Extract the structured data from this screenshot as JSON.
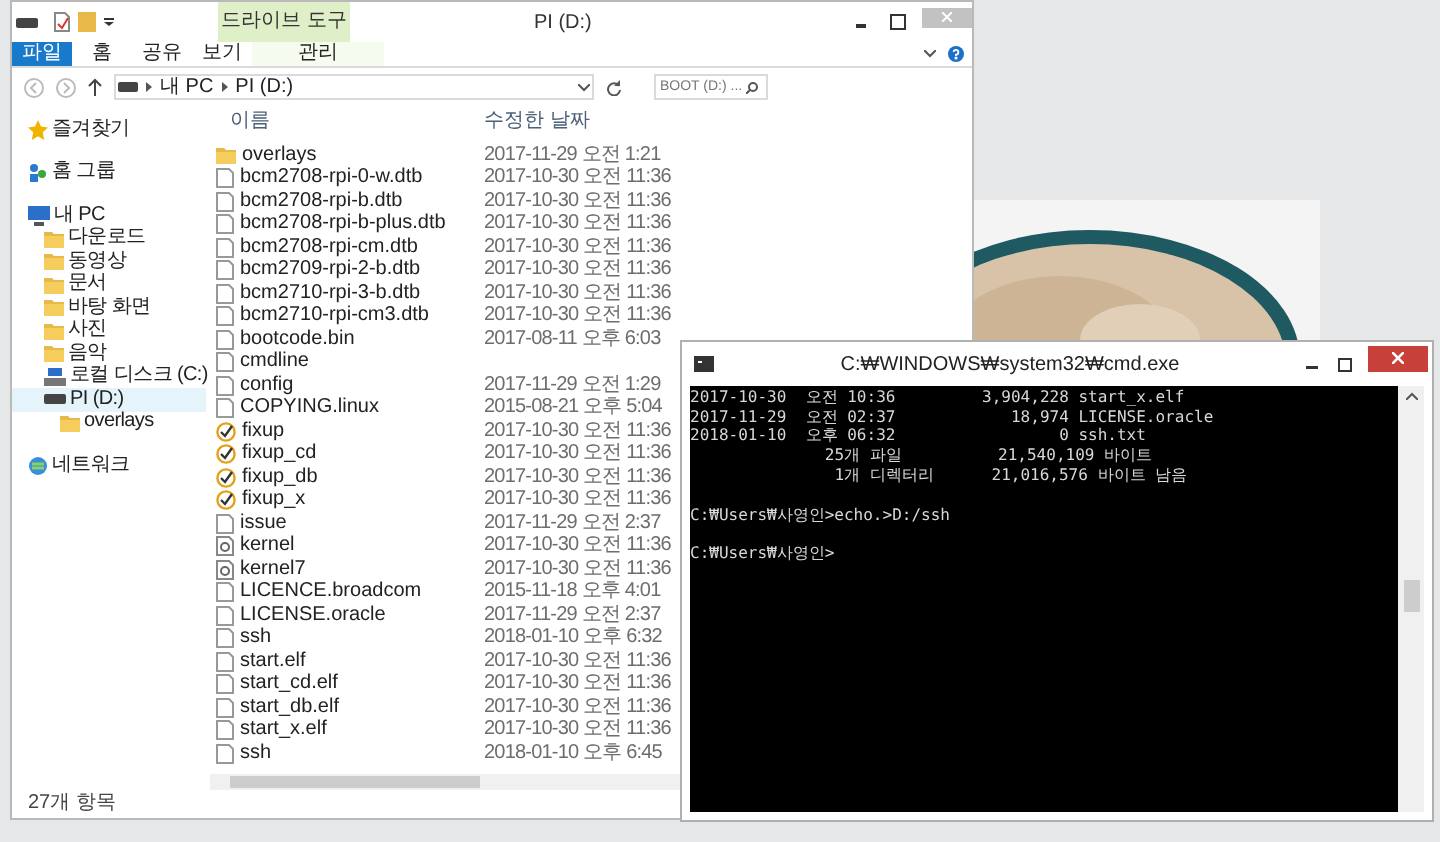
{
  "explorer": {
    "title": "PI (D:)",
    "context_label": "드라이브 도구",
    "ribbon_tabs": [
      {
        "label": "파일",
        "kind": "file"
      },
      {
        "label": "홈",
        "kind": "tab"
      },
      {
        "label": "공유",
        "kind": "tab"
      },
      {
        "label": "보기",
        "kind": "tab"
      },
      {
        "label": "관리",
        "kind": "context"
      }
    ],
    "breadcrumb": [
      "내 PC",
      "PI (D:)"
    ],
    "search": {
      "placeholder": "BOOT (D:) ..."
    },
    "nav": [
      {
        "label": "즐겨찾기",
        "kind": "star",
        "selected": false
      },
      {
        "label": "홈 그룹",
        "kind": "group",
        "selected": false
      },
      {
        "label": "내 PC",
        "kind": "pc",
        "selected": false,
        "children": [
          {
            "label": "다운로드",
            "kind": "folder",
            "selected": false
          },
          {
            "label": "동영상",
            "kind": "folder",
            "selected": false
          },
          {
            "label": "문서",
            "kind": "folder",
            "selected": false
          },
          {
            "label": "바탕 화면",
            "kind": "folder",
            "selected": false
          },
          {
            "label": "사진",
            "kind": "folder",
            "selected": false
          },
          {
            "label": "음악",
            "kind": "folder",
            "selected": false
          },
          {
            "label": "로컬 디스크 (C:)",
            "kind": "disk",
            "selected": false
          },
          {
            "label": "PI (D:)",
            "kind": "drive",
            "selected": true,
            "children": [
              {
                "label": "overlays",
                "kind": "folder",
                "selected": false
              }
            ]
          }
        ]
      },
      {
        "label": "네트워크",
        "kind": "network",
        "selected": false
      }
    ],
    "columns": [
      "이름",
      "수정한 날짜"
    ],
    "files": [
      {
        "name": "overlays",
        "date": "2017-11-29 오전 1:21",
        "kind": "folder"
      },
      {
        "name": "bcm2708-rpi-0-w.dtb",
        "date": "2017-10-30 오전 11:36",
        "kind": "file"
      },
      {
        "name": "bcm2708-rpi-b.dtb",
        "date": "2017-10-30 오전 11:36",
        "kind": "file"
      },
      {
        "name": "bcm2708-rpi-b-plus.dtb",
        "date": "2017-10-30 오전 11:36",
        "kind": "file"
      },
      {
        "name": "bcm2708-rpi-cm.dtb",
        "date": "2017-10-30 오전 11:36",
        "kind": "file"
      },
      {
        "name": "bcm2709-rpi-2-b.dtb",
        "date": "2017-10-30 오전 11:36",
        "kind": "file"
      },
      {
        "name": "bcm2710-rpi-3-b.dtb",
        "date": "2017-10-30 오전 11:36",
        "kind": "file"
      },
      {
        "name": "bcm2710-rpi-cm3.dtb",
        "date": "2017-10-30 오전 11:36",
        "kind": "file"
      },
      {
        "name": "bootcode.bin",
        "date": "2017-08-11 오후 6:03",
        "kind": "file"
      },
      {
        "name": "cmdline",
        "kind": "file"
      },
      {
        "name": "config",
        "date": "2017-11-29 오전 1:29",
        "kind": "file"
      },
      {
        "name": "COPYING.linux",
        "date": "2015-08-21 오후 5:04",
        "kind": "file"
      },
      {
        "name": "fixup",
        "date": "2017-10-30 오전 11:36",
        "kind": "check"
      },
      {
        "name": "fixup_cd",
        "date": "2017-10-30 오전 11:36",
        "kind": "check"
      },
      {
        "name": "fixup_db",
        "date": "2017-10-30 오전 11:36",
        "kind": "check"
      },
      {
        "name": "fixup_x",
        "date": "2017-10-30 오전 11:36",
        "kind": "check"
      },
      {
        "name": "issue",
        "date": "2017-11-29 오전 2:37",
        "kind": "file"
      },
      {
        "name": "kernel",
        "date": "2017-10-30 오전 11:36",
        "kind": "system"
      },
      {
        "name": "kernel7",
        "date": "2017-10-30 오전 11:36",
        "kind": "system"
      },
      {
        "name": "LICENCE.broadcom",
        "date": "2015-11-18 오후 4:01",
        "kind": "file"
      },
      {
        "name": "LICENSE.oracle",
        "date": "2017-11-29 오전 2:37",
        "kind": "file"
      },
      {
        "name": "ssh",
        "date": "2018-01-10 오후 6:32",
        "kind": "file"
      },
      {
        "name": "start.elf",
        "date": "2017-10-30 오전 11:36",
        "kind": "file"
      },
      {
        "name": "start_cd.elf",
        "date": "2017-10-30 오전 11:36",
        "kind": "file"
      },
      {
        "name": "start_db.elf",
        "date": "2017-10-30 오전 11:36",
        "kind": "file"
      },
      {
        "name": "start_x.elf",
        "date": "2017-10-30 오전 11:36",
        "kind": "file"
      },
      {
        "name": "ssh",
        "date": "2018-01-10 오후 6:45",
        "kind": "file"
      }
    ],
    "status": "27개 항목"
  },
  "console": {
    "title": "C:₩WINDOWS₩system32₩cmd.exe",
    "blocks": [
      [
        "2017-10-30  오전 10:36         3,904,228 start_x.elf",
        "2017-11-29  오전 02:37            18,974 LICENSE.oracle",
        "2018-01-10  오후 06:32                 0 ssh.txt",
        "              25개 파일          21,540,109 바이트",
        "               1개 디렉터리      21,016,576 바이트 남음"
      ],
      [
        "C:₩Users₩사영인>echo.>D:/ssh"
      ],
      [
        "C:₩Users₩사영인>"
      ]
    ]
  }
}
